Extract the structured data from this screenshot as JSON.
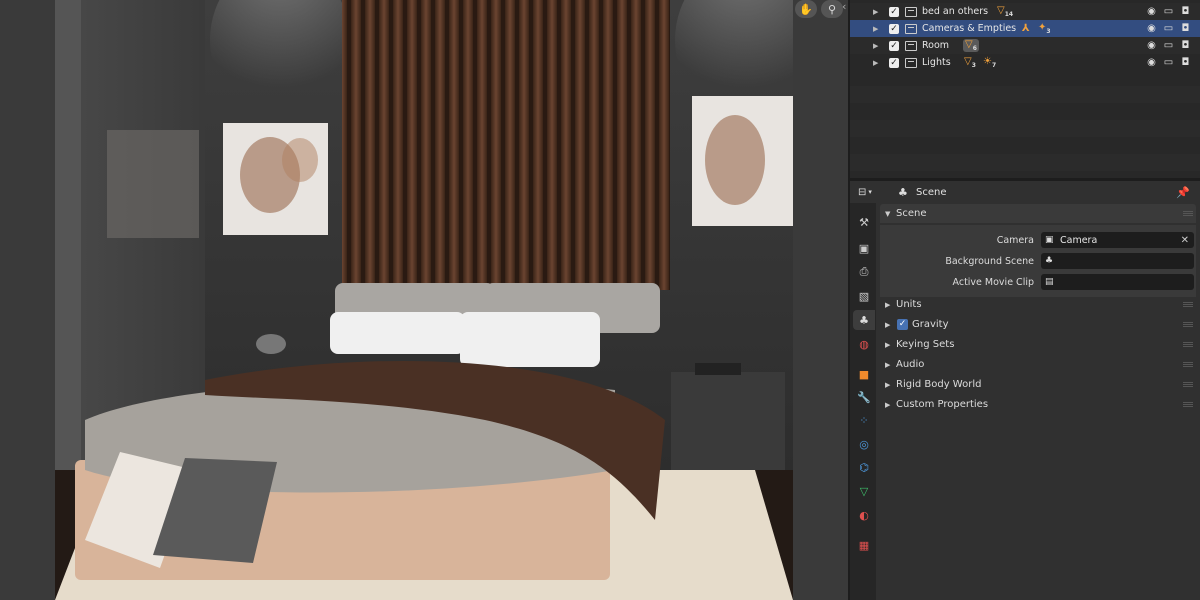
{
  "viewport": {
    "tools": [
      {
        "icon": "hand-icon",
        "glyph": "✋"
      },
      {
        "icon": "zoom-icon",
        "glyph": "⚲"
      }
    ],
    "chevron": "‹"
  },
  "outliner": {
    "rows": [
      {
        "name": "bed an others",
        "badge_glyph": "▽",
        "badge_count": "14"
      },
      {
        "name": "Cameras & Empties",
        "badge_glyph": "✦",
        "badge_count": "3",
        "selected": true
      },
      {
        "name": "Room",
        "badge_glyph": "▽",
        "badge_count": "6"
      },
      {
        "name": "Lights",
        "badge_glyph": "▽",
        "badge_count": "3",
        "badge2_count": "7"
      }
    ],
    "check": "✓"
  },
  "properties": {
    "header_title": "Scene",
    "panels": {
      "scene": {
        "label": "Scene",
        "camera_label": "Camera",
        "camera_value": "Camera",
        "background_label": "Background Scene",
        "background_value": "",
        "movieclip_label": "Active Movie Clip",
        "movieclip_value": ""
      },
      "units": "Units",
      "gravity": "Gravity",
      "keying_sets": "Keying Sets",
      "audio": "Audio",
      "rigid_body": "Rigid Body World",
      "custom_props": "Custom Properties"
    },
    "tabs": [
      {
        "icon": "tool-icon",
        "color": "#cccccc"
      },
      {
        "icon": "render-icon",
        "color": "#cccccc"
      },
      {
        "icon": "output-icon",
        "color": "#cccccc"
      },
      {
        "icon": "view-layer-icon",
        "color": "#cccccc"
      },
      {
        "icon": "scene-icon",
        "color": "#dddddd",
        "active": true
      },
      {
        "icon": "world-icon",
        "color": "#e0504f"
      },
      {
        "icon": "object-icon",
        "color": "#f08a2c"
      },
      {
        "icon": "modifier-icon",
        "color": "#4f9be0"
      },
      {
        "icon": "particles-icon",
        "color": "#4f9be0"
      },
      {
        "icon": "physics-icon",
        "color": "#4f9be0"
      },
      {
        "icon": "constraints-icon",
        "color": "#4f9be0"
      },
      {
        "icon": "data-icon",
        "color": "#3fbf6b"
      },
      {
        "icon": "material-icon",
        "color": "#e0504f"
      },
      {
        "icon": "texture-icon",
        "color": "#e0504f"
      }
    ]
  },
  "colors": {
    "selection": "#334d80",
    "accent": "#4772b3",
    "badge_orange": "#f2a23c"
  }
}
